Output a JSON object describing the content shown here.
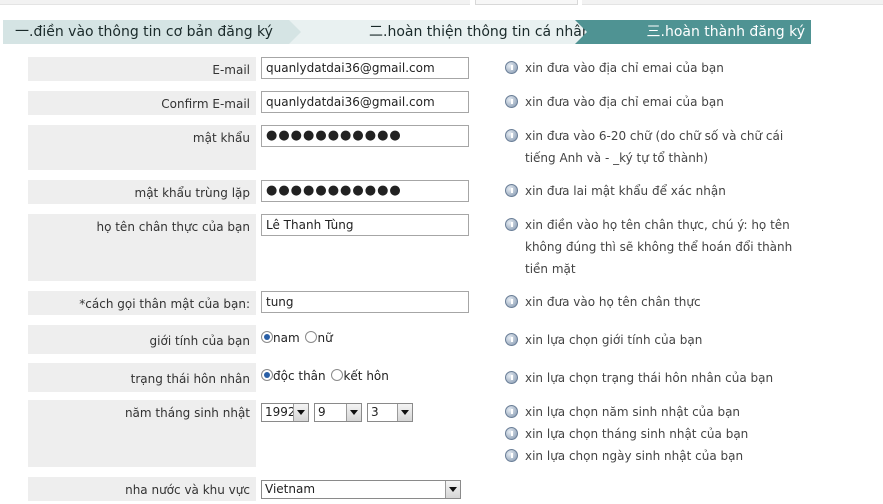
{
  "steps": [
    {
      "label": "一.điền vào thông tin cơ bản đăng ký"
    },
    {
      "label": "二.hoàn thiện thông tin cá nhân"
    },
    {
      "label": "三.hoàn thành đăng ký"
    }
  ],
  "form": {
    "email": {
      "label": "E-mail",
      "value": "quanlydatdai36@gmail.com",
      "hint": "xin đưa vào địa chỉ emai của bạn"
    },
    "confirm_email": {
      "label": "Confirm E-mail",
      "value": "quanlydatdai36@gmail.com",
      "hint": "xin đưa vào địa chỉ emai của bạn"
    },
    "password": {
      "label": "mật khẩu",
      "value": "●●●●●●●●●●●",
      "hint_lines": [
        "xin đưa vào 6-20 chữ (do chữ số và chữ cái",
        "tiếng Anh và - _ký tự tổ thành)"
      ]
    },
    "password_repeat": {
      "label": "mật khẩu trùng lặp",
      "value": "●●●●●●●●●●●",
      "hint": "xin đưa lai mật khẩu để xác nhận"
    },
    "real_name": {
      "label": "họ tên chân thực của bạn",
      "value": "Lê Thanh Tùng",
      "hint_lines": [
        "xin điền vào họ tên chân thực, chú ý: họ tên",
        "không đúng thì sẽ không thể hoán đổi thành",
        "tiền mặt"
      ]
    },
    "nickname": {
      "label": "*cách gọi thân mật của bạn:",
      "value": "tung",
      "hint": "xin đưa vào họ tên chân thực"
    },
    "gender": {
      "label": "giới tính của bạn",
      "options": [
        "nam",
        "nữ"
      ],
      "selected": "nam",
      "hint": "xin lựa chọn giới tính của bạn"
    },
    "marital": {
      "label": "trạng thái hôn nhân",
      "options": [
        "độc thân",
        "kết hôn"
      ],
      "selected": "độc thân",
      "hint": "xin lựa chọn trạng thái hôn nhân của bạn"
    },
    "birthday": {
      "label": "năm tháng sinh nhật",
      "year": "1992",
      "month": "9",
      "day": "3",
      "hints": [
        "xin lựa chọn năm sinh nhật của bạn",
        "xin lựa chọn tháng sinh nhật của bạn",
        "xin lựa chọn ngày sinh nhật của bạn"
      ]
    },
    "country": {
      "label": "nha nước và khu vực",
      "value": "Vietnam"
    }
  },
  "icons": {
    "hint": "info-icon"
  },
  "colors": {
    "active_step": "#4f9393",
    "step_light": "#d5e4e4",
    "label_bg": "#eeeeee"
  }
}
